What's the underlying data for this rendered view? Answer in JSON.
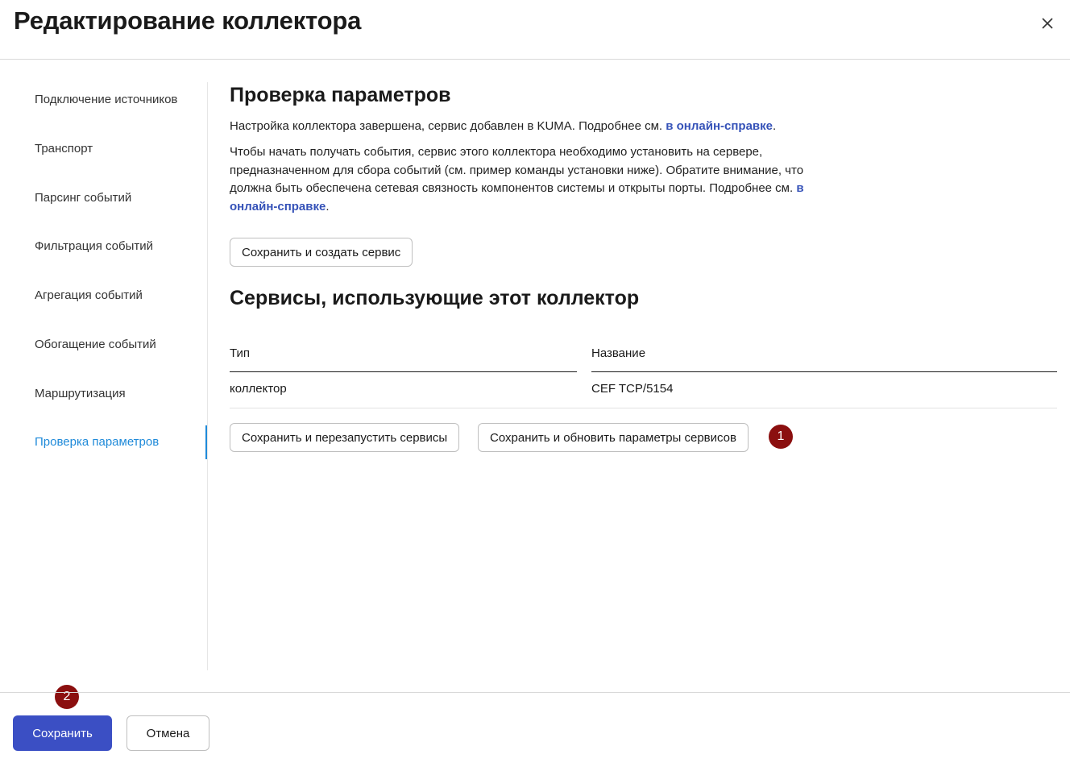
{
  "header": {
    "title": "Редактирование коллектора",
    "close_icon": "close-icon"
  },
  "sidebar": {
    "items": [
      {
        "label": "Подключение источников"
      },
      {
        "label": "Транспорт"
      },
      {
        "label": "Парсинг событий"
      },
      {
        "label": "Фильтрация событий"
      },
      {
        "label": "Агрегация событий"
      },
      {
        "label": "Обогащение событий"
      },
      {
        "label": "Маршрутизация"
      },
      {
        "label": "Проверка параметров",
        "active": true
      }
    ]
  },
  "main": {
    "check_title": "Проверка параметров",
    "para1_text": "Настройка коллектора завершена, сервис добавлен в KUMA. Подробнее см. ",
    "para1_link": "в онлайн-справке",
    "para1_end": ".",
    "para2_text": "Чтобы начать получать события, сервис этого коллектора необходимо установить на сервере, предназначенном для сбора событий (см. пример команды установки ниже). Обратите внимание, что должна быть обеспечена сетевая связность компонентов системы и открыты порты. Подробнее см. ",
    "para2_link": "в онлайн-справке",
    "para2_end": ".",
    "save_create_label": "Сохранить и создать сервис",
    "services_title": "Сервисы, использующие этот коллектор",
    "table": {
      "columns": [
        "Тип",
        "Название"
      ],
      "rows": [
        [
          "коллектор",
          "CEF TCP/5154"
        ]
      ]
    },
    "save_restart_label": "Сохранить и перезапустить сервисы",
    "save_update_label": "Сохранить и обновить параметры сервисов",
    "badge1": "1"
  },
  "footer": {
    "badge2": "2",
    "save_label": "Сохранить",
    "cancel_label": "Отмена"
  },
  "colors": {
    "accent": "#1f8ad9",
    "primary_button": "#3b4fc4",
    "link": "#3552b8",
    "badge": "#8b0f0f"
  }
}
